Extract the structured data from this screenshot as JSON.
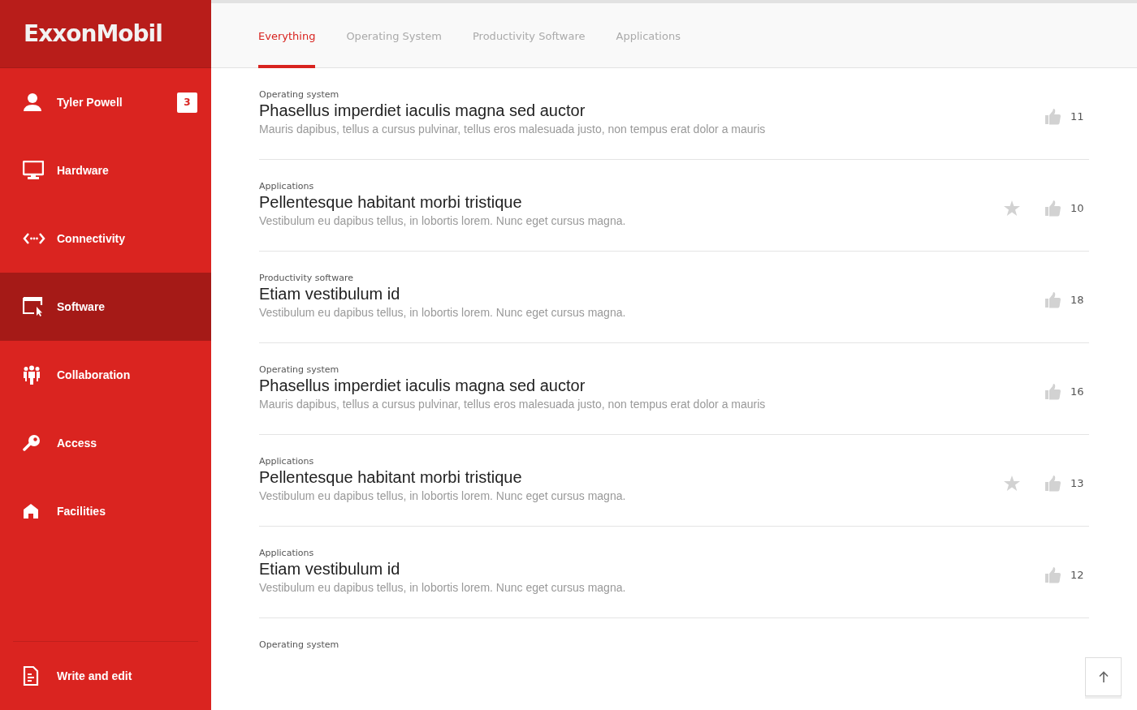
{
  "logo": {
    "text": "ExxonMobil"
  },
  "sidebar": {
    "items": [
      {
        "label": "Tyler Powell",
        "badge": "3",
        "selected": false
      },
      {
        "label": "Hardware",
        "selected": false
      },
      {
        "label": "Connectivity",
        "selected": false
      },
      {
        "label": "Software",
        "selected": true
      },
      {
        "label": "Collaboration",
        "selected": false
      },
      {
        "label": "Access",
        "selected": false
      },
      {
        "label": "Facilities",
        "selected": false
      }
    ],
    "footer_item": {
      "label": "Write and edit"
    }
  },
  "tabs": [
    {
      "label": "Everything",
      "selected": true
    },
    {
      "label": "Operating System",
      "selected": false
    },
    {
      "label": "Productivity Software",
      "selected": false
    },
    {
      "label": "Applications",
      "selected": false
    }
  ],
  "articles": [
    {
      "category": "Operating system",
      "title": "Phasellus imperdiet iaculis magna sed auctor",
      "summary": "Mauris dapibus, tellus a cursus pulvinar, tellus eros malesuada justo, non tempus erat dolor a mauris",
      "starred": false,
      "likes": "11"
    },
    {
      "category": "Applications",
      "title": "Pellentesque habitant morbi tristique",
      "summary": "Vestibulum eu dapibus tellus, in lobortis lorem. Nunc eget cursus magna.",
      "starred": true,
      "likes": "10"
    },
    {
      "category": "Productivity software",
      "title": "Etiam vestibulum id",
      "summary": "Vestibulum eu dapibus tellus, in lobortis lorem. Nunc eget cursus magna.",
      "starred": false,
      "likes": "18"
    },
    {
      "category": "Operating system",
      "title": "Phasellus imperdiet iaculis magna sed auctor",
      "summary": "Mauris dapibus, tellus a cursus pulvinar, tellus eros malesuada justo, non tempus erat dolor a mauris",
      "starred": false,
      "likes": "16"
    },
    {
      "category": "Applications",
      "title": "Pellentesque habitant morbi tristique",
      "summary": "Vestibulum eu dapibus tellus, in lobortis lorem. Nunc eget cursus magna.",
      "starred": true,
      "likes": "13"
    },
    {
      "category": "Applications",
      "title": "Etiam vestibulum id",
      "summary": "Vestibulum eu dapibus tellus, in lobortis lorem. Nunc eget cursus magna.",
      "starred": false,
      "likes": "12"
    },
    {
      "category": "Operating system"
    }
  ]
}
